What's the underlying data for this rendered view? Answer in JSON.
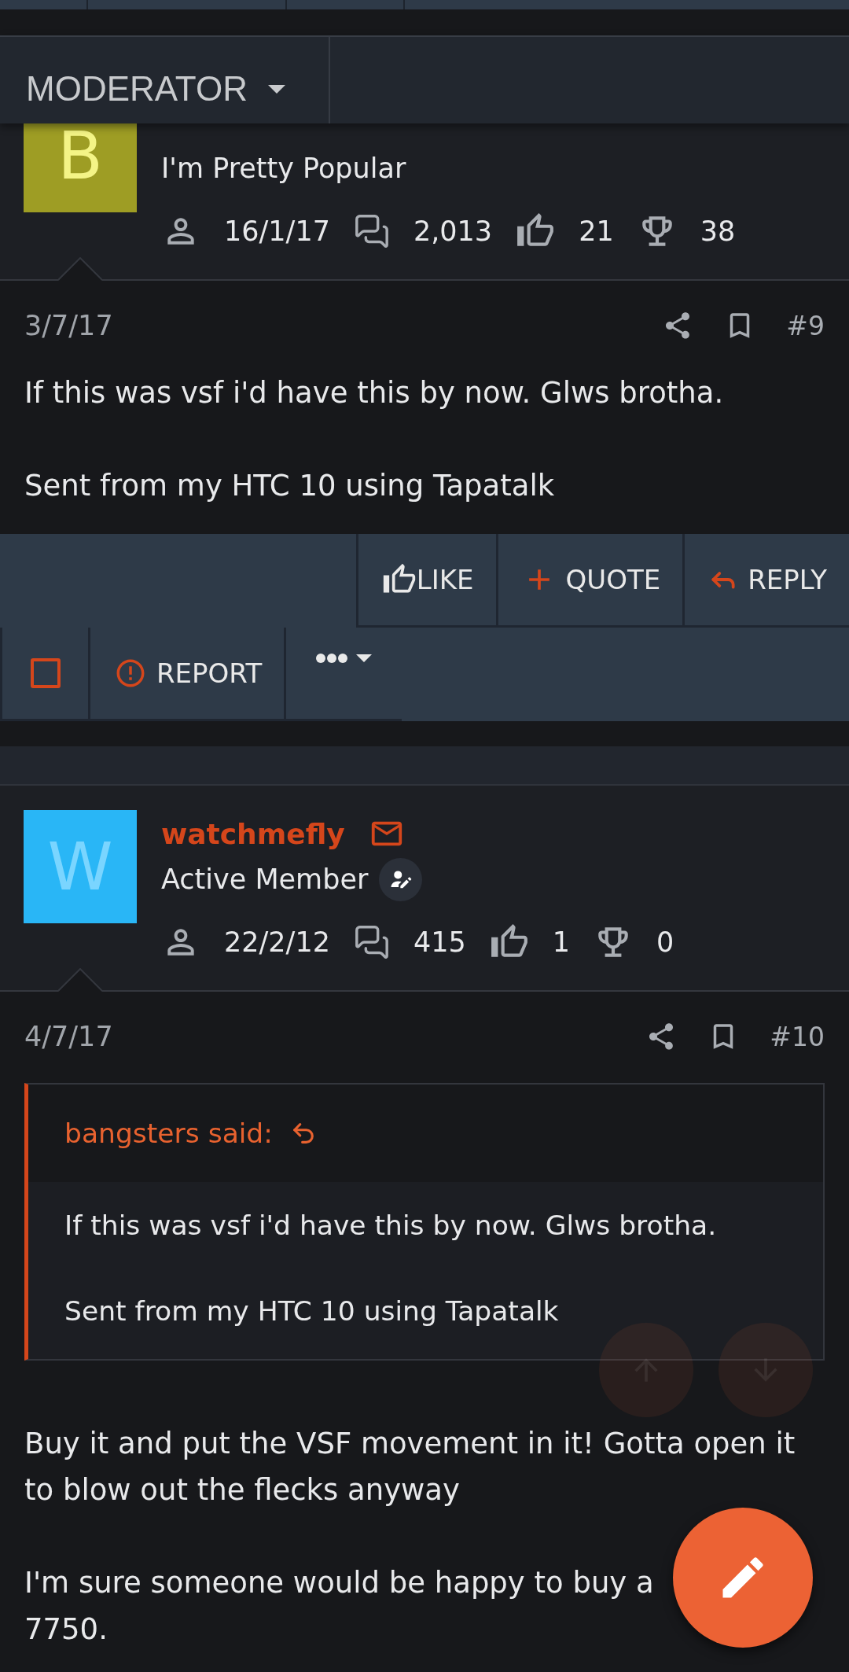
{
  "moderator_menu": {
    "label": "MODERATOR"
  },
  "posts": [
    {
      "author": {
        "avatar_letter": "B",
        "color": "#9e9d24",
        "title": "I'm Pretty Popular",
        "stats": {
          "joined": "16/1/17",
          "messages": "2,013",
          "reactions": "21",
          "points": "38"
        }
      },
      "date": "3/7/17",
      "number": "#9",
      "paragraphs": [
        "If this was vsf i'd have this by now. Glws brotha.",
        "Sent from my HTC 10 using Tapatalk"
      ],
      "actions": {
        "like": "LIKE",
        "quote": "QUOTE",
        "reply": "REPLY",
        "select": {
          "checked": false
        },
        "report": "REPORT"
      }
    },
    {
      "author": {
        "name": "watchmefly",
        "avatar_letter": "W",
        "color": "#29b6f6",
        "title": "Active Member",
        "badge": true,
        "stats": {
          "joined": "22/2/12",
          "messages": "415",
          "reactions": "1",
          "points": "0"
        }
      },
      "date": "4/7/17",
      "number": "#10",
      "quote": {
        "attribution": "bangsters said:",
        "paragraphs": [
          "If this was vsf i'd have this by now. Glws brotha.",
          "Sent from my HTC 10 using Tapatalk"
        ]
      },
      "paragraphs": [
        "Buy it and put the VSF movement in it! Gotta open it to blow out the flecks anyway",
        "I'm sure someone would be happy to buy a\n7750."
      ]
    }
  ]
}
